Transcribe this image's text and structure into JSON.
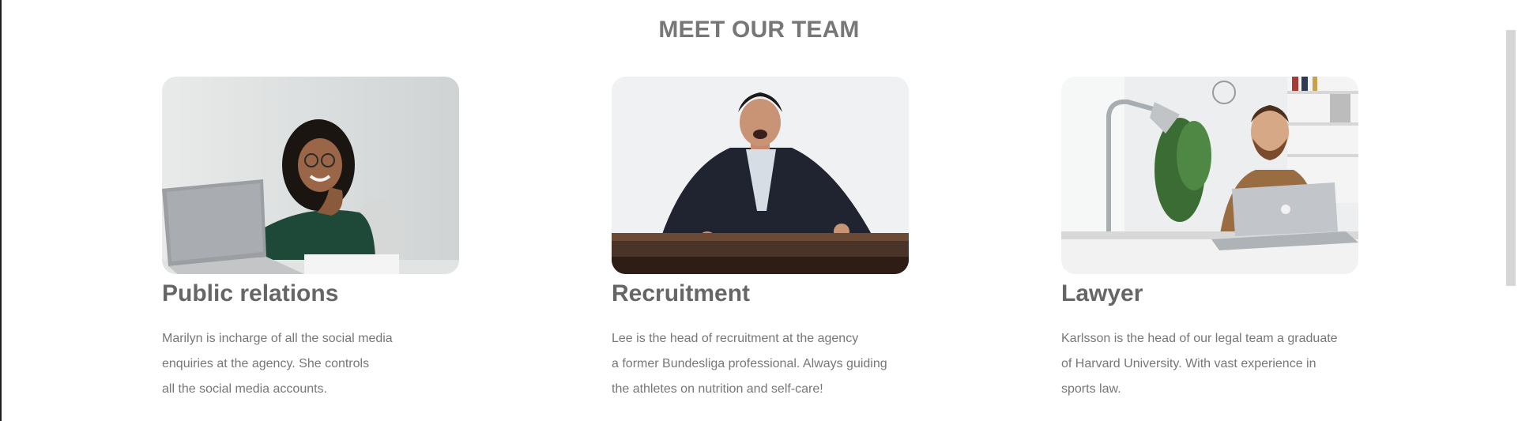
{
  "section": {
    "title": "MEET OUR TEAM"
  },
  "team": [
    {
      "role": "Public relations",
      "lines": [
        "Marilyn is incharge of all the social media",
        "enquiries at the agency. She controls",
        "all the social media accounts."
      ],
      "photo_icon": "woman-with-laptop-photo"
    },
    {
      "role": "Recruitment",
      "lines": [
        "Lee is the head of recruitment at the agency",
        "a former Bundesliga professional. Always guiding",
        "the athletes on nutrition and self-care!"
      ],
      "photo_icon": "man-shouting-at-desk-photo"
    },
    {
      "role": "Lawyer",
      "lines": [
        "Karlsson is the head of our legal team a graduate",
        "of Harvard University. With vast experience in",
        "sports law."
      ],
      "photo_icon": "man-at-office-desk-photo"
    }
  ],
  "colors": {
    "title": "#777777",
    "role": "#666666",
    "text": "#777777",
    "scrollbar": "#d6d6d6"
  }
}
